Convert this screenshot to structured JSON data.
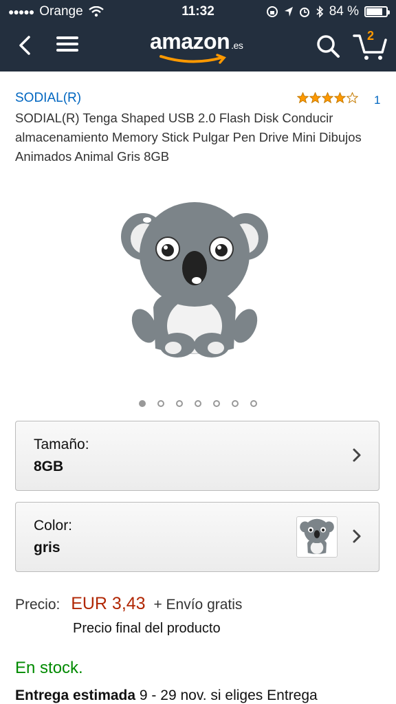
{
  "status_bar": {
    "signal_dots": "●●●●●",
    "carrier": "Orange",
    "time": "11:32",
    "battery_text": "84 %",
    "battery_level": 0.84
  },
  "nav": {
    "logo_text": "amazon",
    "logo_tld": ".es",
    "cart_count": "2"
  },
  "product": {
    "brand": "SODIAL(R)",
    "rating_stars": 4,
    "rating_count": "1",
    "title": "SODIAL(R) Tenga Shaped USB 2.0 Flash Disk Conducir almacenamiento Memory Stick Pulgar Pen Drive Mini Dibujos Animados Animal Gris 8GB",
    "image_icon": "koala-usb-image",
    "image_count": 7,
    "active_image_index": 0
  },
  "selectors": {
    "size": {
      "label": "Tamaño:",
      "value": "8GB"
    },
    "color": {
      "label": "Color:",
      "value": "gris"
    }
  },
  "price": {
    "label": "Precio:",
    "amount": "EUR 3,43",
    "shipping": "+ Envío gratis",
    "final_note": "Precio final del producto"
  },
  "availability": {
    "stock": "En stock.",
    "delivery_label": "Entrega estimada",
    "delivery_text": "9 - 29 nov. si eliges Entrega"
  },
  "colors": {
    "header_bg": "#232f3e",
    "link": "#0066c0",
    "price": "#b12704",
    "stock": "#008a00",
    "accent": "#ff9900"
  }
}
